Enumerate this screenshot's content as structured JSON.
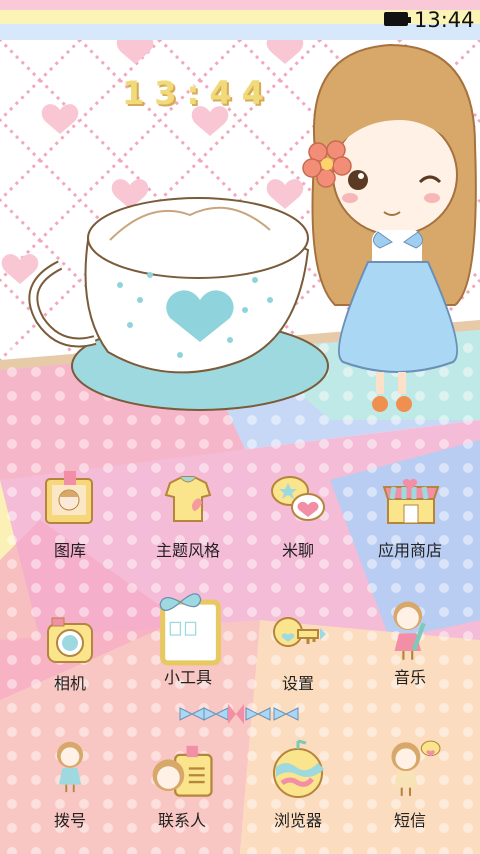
{
  "status_bar": {
    "time": "13:44"
  },
  "clock_widget": {
    "time": "13:44"
  },
  "apps": [
    {
      "label": "图库",
      "icon": "photo-frame-icon"
    },
    {
      "label": "主题风格",
      "icon": "dress-icon"
    },
    {
      "label": "米聊",
      "icon": "chat-bubbles-icon"
    },
    {
      "label": "应用商店",
      "icon": "shop-icon"
    },
    {
      "label": "相机",
      "icon": "camera-icon"
    },
    {
      "label": "小工具",
      "icon": "widget-board-icon"
    },
    {
      "label": "设置",
      "icon": "key-settings-icon"
    },
    {
      "label": "音乐",
      "icon": "girl-guitar-icon"
    },
    {
      "label": "拨号",
      "icon": "girl-phone-icon"
    },
    {
      "label": "联系人",
      "icon": "contact-card-icon"
    },
    {
      "label": "浏览器",
      "icon": "globe-icon"
    },
    {
      "label": "短信",
      "icon": "girl-message-icon"
    }
  ],
  "colors": {
    "pink": "#f6b6c9",
    "blue": "#b9d7f2",
    "yellow": "#fbf0b6",
    "mint": "#bfe9e6"
  }
}
